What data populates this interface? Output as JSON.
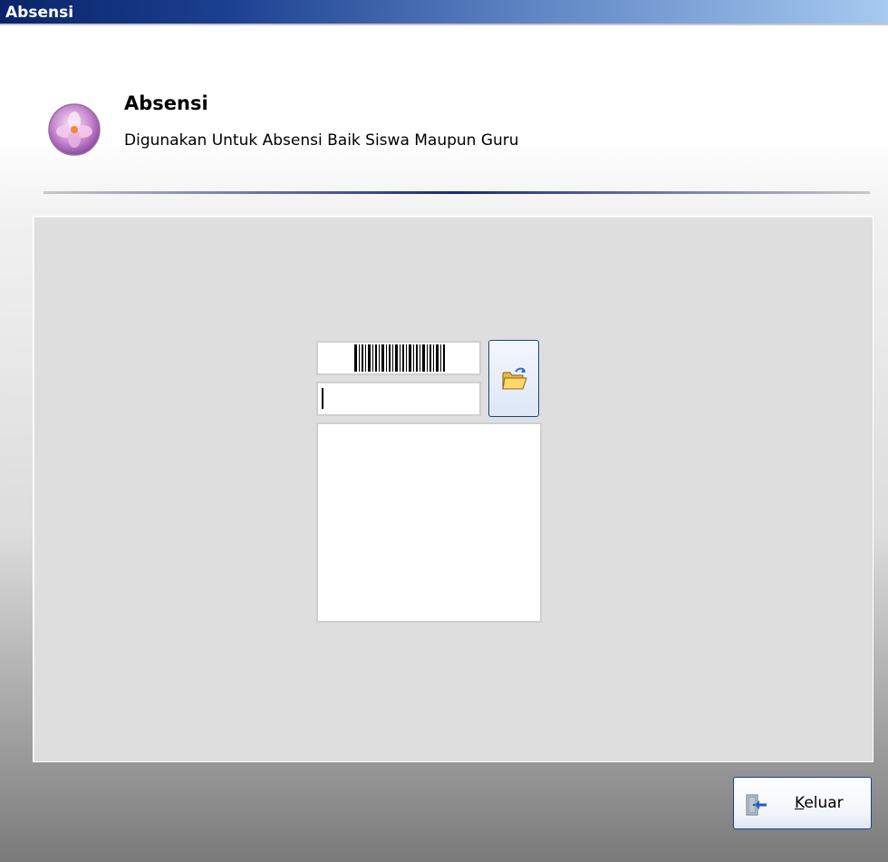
{
  "window": {
    "title": "Absensi"
  },
  "header": {
    "title": "Absensi",
    "subtitle": "Digunakan Untuk Absensi Baik Siswa Maupun Guru",
    "icon": "purple-flower-app-icon"
  },
  "form": {
    "barcode_icon": "barcode-image",
    "code_value": "",
    "open_icon": "open-folder-icon",
    "result_text": ""
  },
  "footer": {
    "exit_label": "Keluar",
    "exit_icon": "exit-door-icon"
  },
  "colors": {
    "titlebar_start": "#0a246a",
    "titlebar_end": "#a6caf0",
    "button_border": "#1d3f8f"
  }
}
